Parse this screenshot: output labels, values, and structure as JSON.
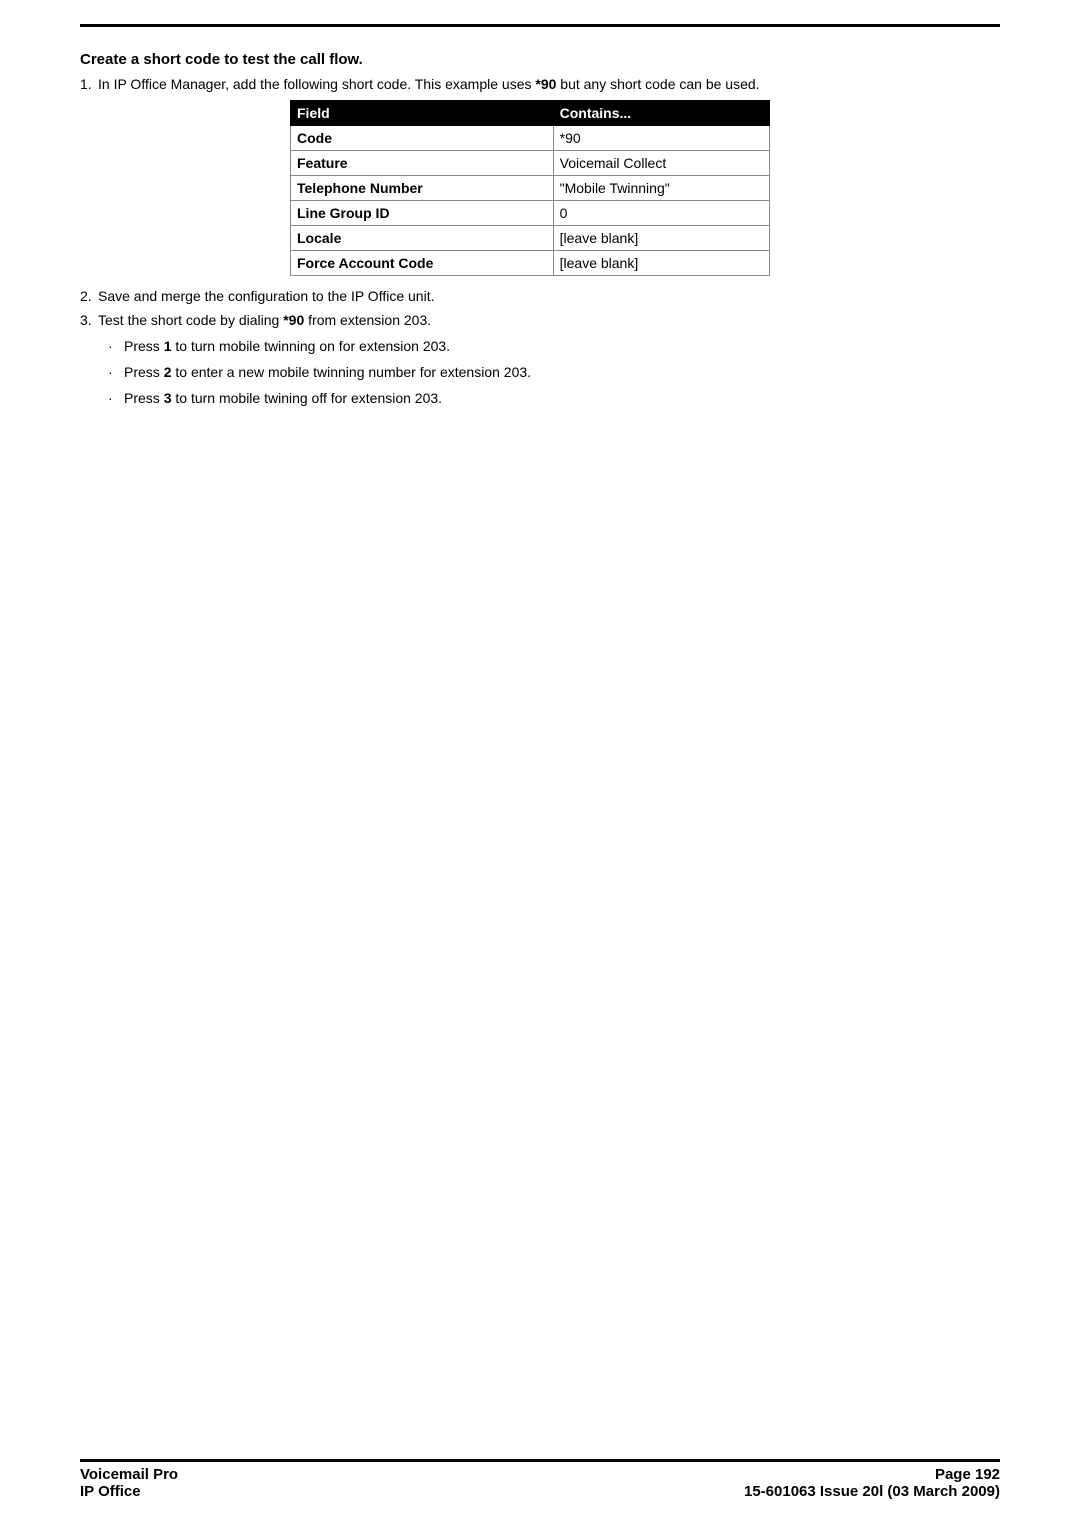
{
  "heading": "Create a short code to test the call flow.",
  "step1": {
    "num": "1.",
    "pre": "In IP Office Manager, add the following short code. This example uses ",
    "code": "*90",
    "post": " but any short code can be used."
  },
  "table": {
    "headers": [
      "Field",
      "Contains..."
    ],
    "rows": [
      [
        "Code",
        "*90"
      ],
      [
        "Feature",
        "Voicemail Collect"
      ],
      [
        "Telephone Number",
        "\"Mobile Twinning\""
      ],
      [
        "Line Group ID",
        "0"
      ],
      [
        "Locale",
        "[leave blank]"
      ],
      [
        "Force Account Code",
        "[leave blank]"
      ]
    ]
  },
  "step2": {
    "num": "2.",
    "text": "Save and merge the configuration to the IP Office unit."
  },
  "step3": {
    "num": "3.",
    "pre": "Test the short code by dialing ",
    "code": "*90",
    "post": " from extension 203."
  },
  "bullets": [
    {
      "pre": "Press ",
      "key": "1",
      "post": " to turn mobile twinning on for extension 203."
    },
    {
      "pre": "Press ",
      "key": "2",
      "post": " to enter a new mobile twinning number for extension 203."
    },
    {
      "pre": "Press ",
      "key": "3",
      "post": " to turn mobile twining off for extension 203."
    }
  ],
  "footer": {
    "left1": "Voicemail Pro",
    "left2": "IP Office",
    "right1": "Page 192",
    "right2": "15-601063 Issue 20l (03 March 2009)"
  }
}
